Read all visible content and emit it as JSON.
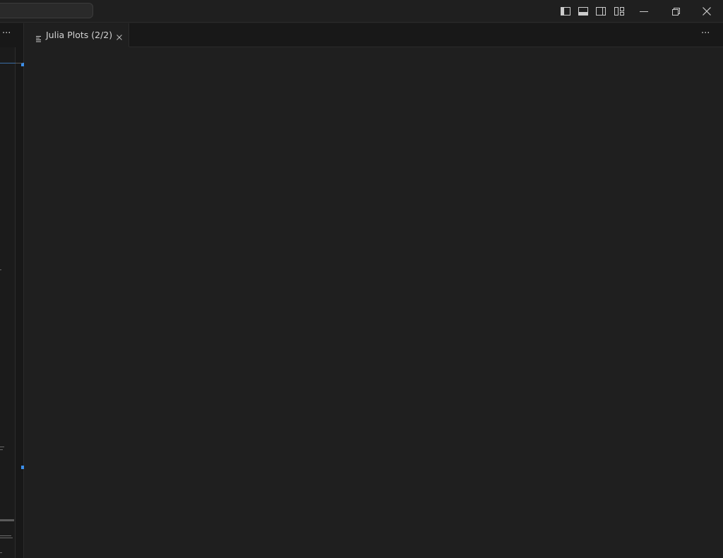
{
  "titlebar": {
    "icons": [
      "toggle-primary-sidebar-icon",
      "toggle-panel-icon",
      "toggle-secondary-sidebar-icon",
      "customize-layout-icon",
      "minimize-icon",
      "restore-icon",
      "close-icon"
    ]
  },
  "left_panel": {
    "more_label": "···"
  },
  "editor": {
    "tab": {
      "label": "Julia Plots (2/2)",
      "icon": "preview-lines-icon",
      "close_icon": "close-icon"
    },
    "more_label": "···"
  },
  "colors": {
    "background": "#1f1f1f",
    "sidebar": "#181818",
    "border": "#2b2b2b",
    "accent": "#3b8eea"
  }
}
